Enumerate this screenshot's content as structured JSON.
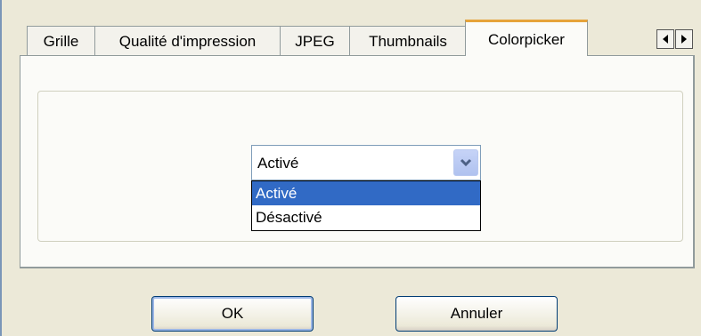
{
  "tabs": [
    {
      "label": "Grille",
      "active": false
    },
    {
      "label": "Qualité d'impression",
      "active": false
    },
    {
      "label": "JPEG",
      "active": false
    },
    {
      "label": "Thumbnails",
      "active": false
    },
    {
      "label": "Colorpicker",
      "active": true
    }
  ],
  "tab_scroll": {
    "left_icon": "triangle-left",
    "right_icon": "triangle-right"
  },
  "combo": {
    "value": "Activé",
    "options": [
      "Activé",
      "Désactivé"
    ],
    "highlighted_option": "Activé"
  },
  "buttons": {
    "ok": "OK",
    "cancel": "Annuler"
  },
  "colors": {
    "selection": "#316ac5",
    "active_tab_accent": "#e6a33a",
    "window_bg": "#ece9d8"
  }
}
